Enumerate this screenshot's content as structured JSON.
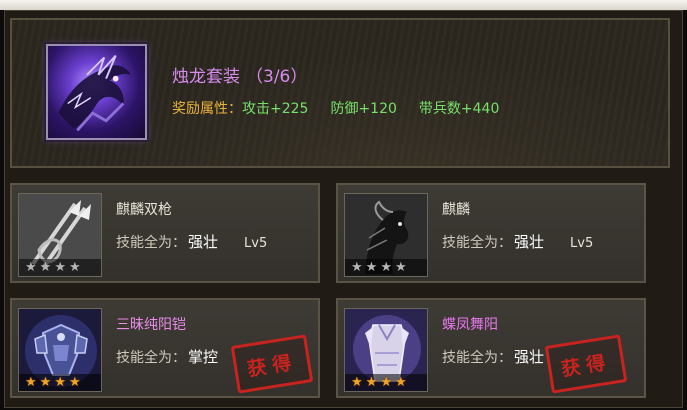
{
  "suit": {
    "icon": "black-dragon-icon",
    "title": "烛龙套装",
    "count": "（3/6）",
    "attr_label": "奖励属性：",
    "attrs": [
      "攻击+225",
      "防御+120",
      "带兵数+440"
    ]
  },
  "cards": [
    {
      "name": "麒麟双枪",
      "icon": "twin-spear-icon",
      "skill_label": "技能全为：",
      "skill": "强壮",
      "level": "Lv5",
      "stars": 4,
      "star_color": "grey",
      "obtained": false
    },
    {
      "name": "麒麟",
      "icon": "black-horse-icon",
      "skill_label": "技能全为：",
      "skill": "强壮",
      "level": "Lv5",
      "stars": 4,
      "star_color": "grey",
      "obtained": false
    },
    {
      "name": "三昧纯阳铠",
      "icon": "armor-icon",
      "skill_label": "技能全为：",
      "skill": "掌控",
      "level": "",
      "stars": 4,
      "star_color": "gold",
      "obtained": true,
      "stamp": "获得"
    },
    {
      "name": "蝶凤舞阳",
      "icon": "robe-icon",
      "skill_label": "技能全为：",
      "skill": "强壮",
      "level": "",
      "stars": 4,
      "star_color": "gold",
      "obtained": true,
      "stamp": "获得"
    }
  ],
  "colors": {
    "suit_title": "#d78bf0",
    "attr_label": "#e9b43c",
    "attr_value": "#77e06a",
    "stamp": "#c8231e"
  }
}
